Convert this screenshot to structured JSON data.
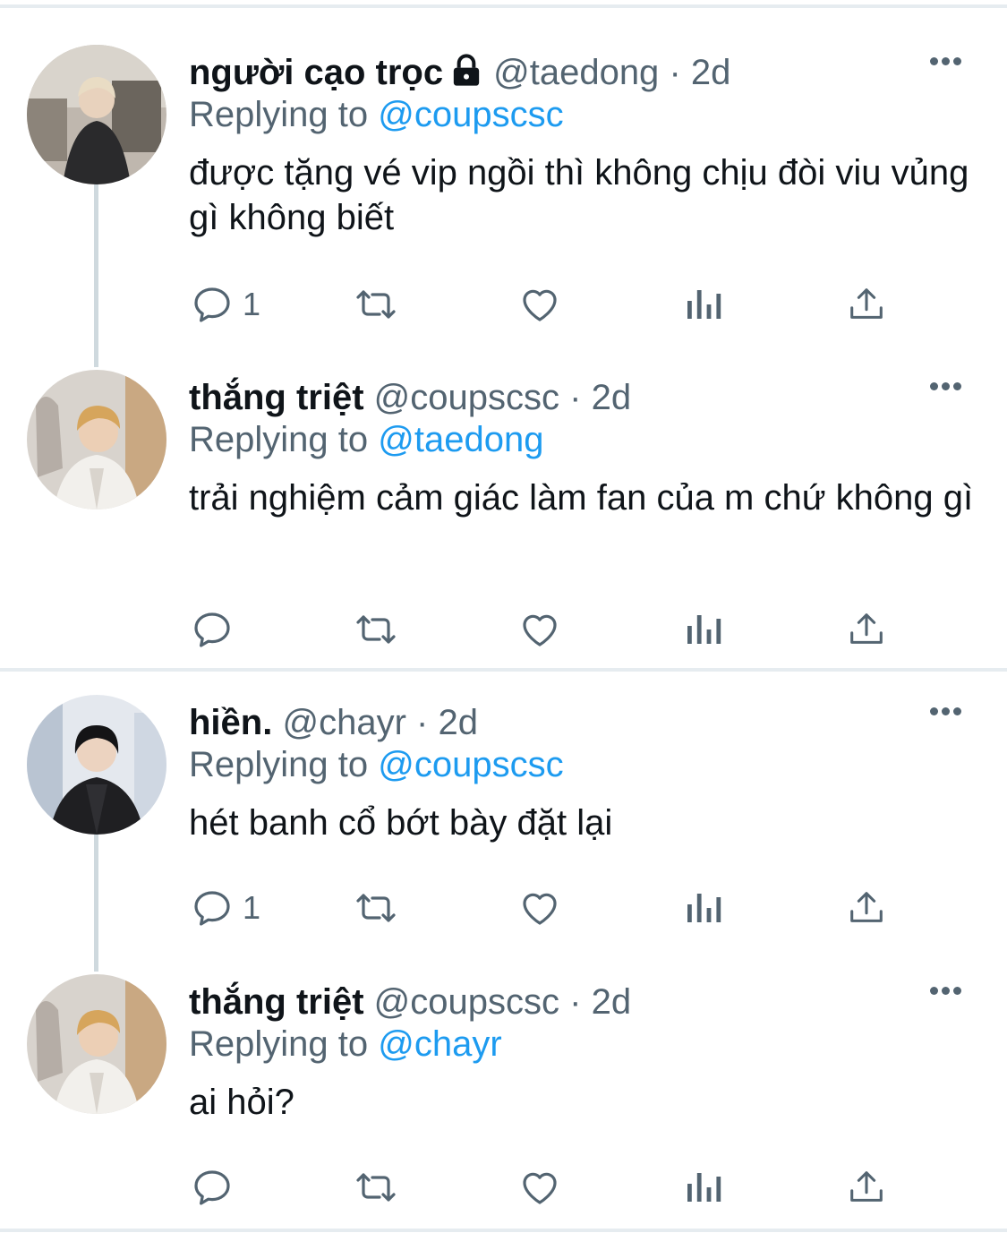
{
  "tweets": [
    {
      "name": "người cạo trọc",
      "has_lock": true,
      "handle": "@taedong",
      "separator": "·",
      "time": "2d",
      "replying_prefix": "Replying to",
      "replying_to": "@coupscsc",
      "text": "được tặng vé vip ngồi thì không chịu đòi viu vủng gì không biết",
      "reply_count": "1"
    },
    {
      "name": "thắng triệt",
      "handle": "@coupscsc",
      "separator": "·",
      "time": "2d",
      "replying_prefix": "Replying to",
      "replying_to": "@taedong",
      "text": "trải nghiệm cảm giác làm fan của m chứ không gì",
      "reply_count": ""
    },
    {
      "name": "hiền.",
      "handle": "@chayr",
      "separator": "·",
      "time": "2d",
      "replying_prefix": "Replying to",
      "replying_to": "@coupscsc",
      "text": "hét banh cổ bớt bày đặt lại",
      "reply_count": "1"
    },
    {
      "name": "thắng triệt",
      "handle": "@coupscsc",
      "separator": "·",
      "time": "2d",
      "replying_prefix": "Replying to",
      "replying_to": "@chayr",
      "text": "ai hỏi?",
      "reply_count": ""
    }
  ],
  "icons": [
    "reply-icon",
    "retweet-icon",
    "like-icon",
    "analytics-icon",
    "share-icon",
    "more-icon",
    "lock-icon"
  ],
  "colors": {
    "link": "#1d9bf0",
    "secondary": "#536471",
    "text": "#0f1419",
    "divider": "#e6ecf0"
  }
}
